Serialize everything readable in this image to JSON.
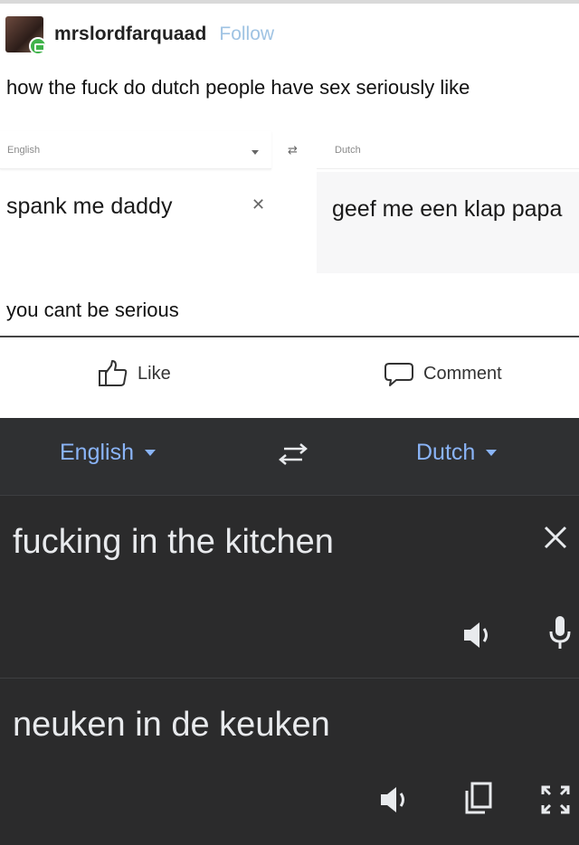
{
  "tumblr": {
    "username": "mrslordfarquaad",
    "follow_label": "Follow",
    "post_text": "how the fuck do dutch people have sex seriously like",
    "embedded_translate": {
      "source_lang": "English",
      "target_lang": "Dutch",
      "source_text": "spank me daddy",
      "target_text": "geef me een klap papa"
    },
    "reply_text": "you cant be serious",
    "like_label": "Like",
    "comment_label": "Comment"
  },
  "translate": {
    "source_lang": "English",
    "target_lang": "Dutch",
    "source_text": "fucking in the kitchen",
    "target_text": "neuken in de keuken",
    "accent_color": "#8ab4f8",
    "icons": [
      "swap-icon",
      "close-icon",
      "speaker-icon",
      "mic-icon",
      "copy-icon",
      "fullscreen-icon"
    ]
  }
}
